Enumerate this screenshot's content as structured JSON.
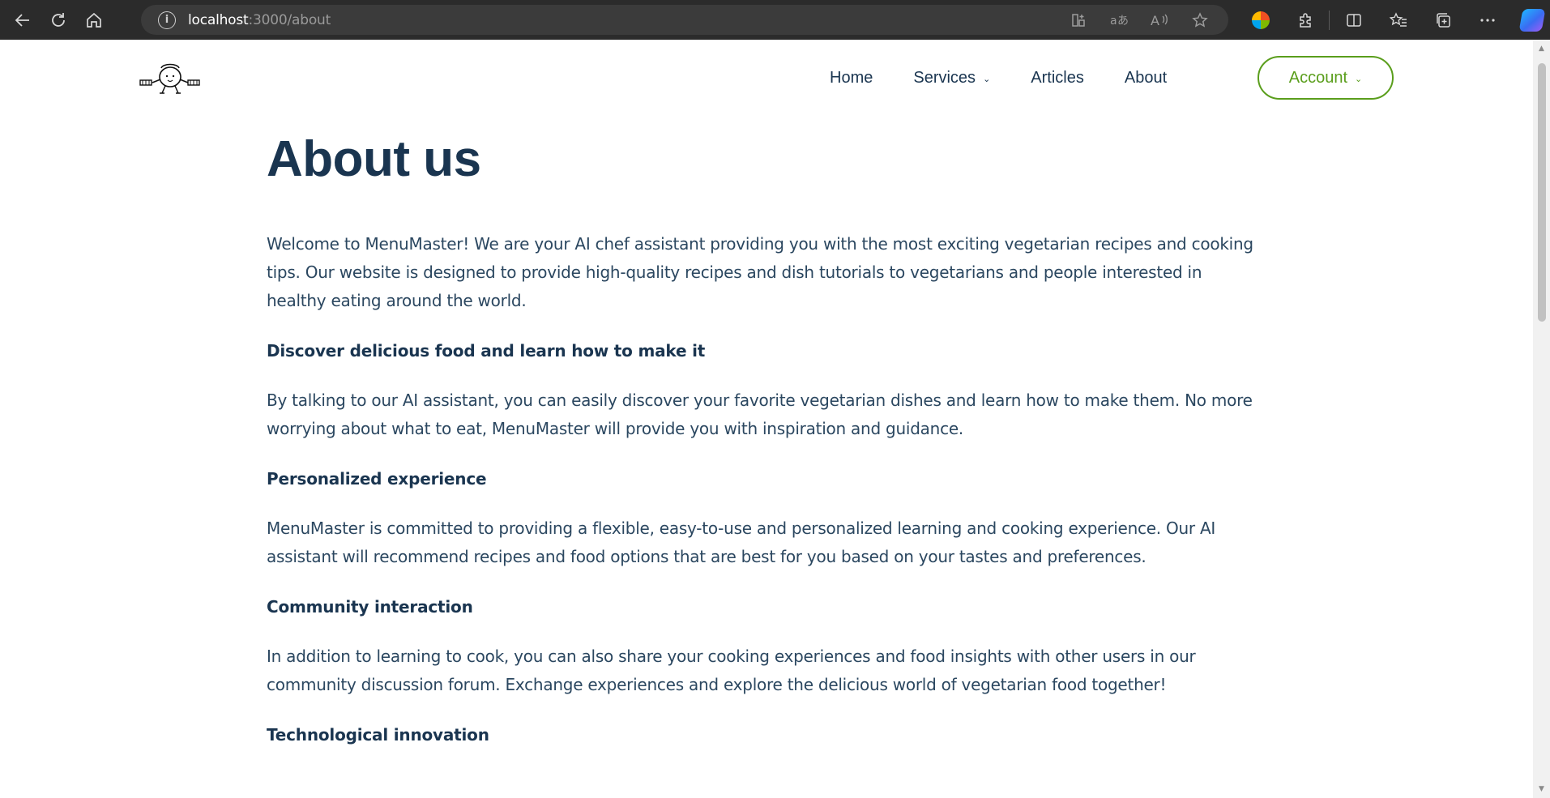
{
  "browser": {
    "url_host": "localhost",
    "url_path": ":3000/about",
    "info_icon": "i",
    "icons": [
      "back-icon",
      "refresh-icon",
      "home-icon",
      "app-available-icon",
      "translate-icon",
      "read-aloud-icon",
      "favorite-star-icon",
      "profile-icon",
      "extensions-icon",
      "split-screen-icon",
      "favorites-icon",
      "collections-icon",
      "more-icon",
      "copilot-icon"
    ]
  },
  "nav": {
    "home": "Home",
    "services": "Services",
    "articles": "Articles",
    "about": "About",
    "account": "Account"
  },
  "content": {
    "title": "About us",
    "intro": "Welcome to MenuMaster! We are your AI chef assistant providing you with the most exciting vegetarian recipes and cooking tips. Our website is designed to provide high-quality recipes and dish tutorials to vegetarians and people interested in healthy eating around the world.",
    "sections": [
      {
        "heading": "Discover delicious food and learn how to make it",
        "text": "By talking to our AI assistant, you can easily discover your favorite vegetarian dishes and learn how to make them. No more worrying about what to eat, MenuMaster will provide you with inspiration and guidance."
      },
      {
        "heading": "Personalized experience",
        "text": "MenuMaster is committed to providing a flexible, easy-to-use and personalized learning and cooking experience. Our AI assistant will recommend recipes and food options that are best for you based on your tastes and preferences."
      },
      {
        "heading": "Community interaction",
        "text": "In addition to learning to cook, you can also share your cooking experiences and food insights with other users in our community discussion forum. Exchange experiences and explore the delicious world of vegetarian food together!"
      },
      {
        "heading": "Technological innovation",
        "text": ""
      }
    ]
  },
  "colors": {
    "heading": "#1a3550",
    "body_text": "#2b4760",
    "accent": "#5a9e1c",
    "browser_bg": "#2b2b2b"
  }
}
